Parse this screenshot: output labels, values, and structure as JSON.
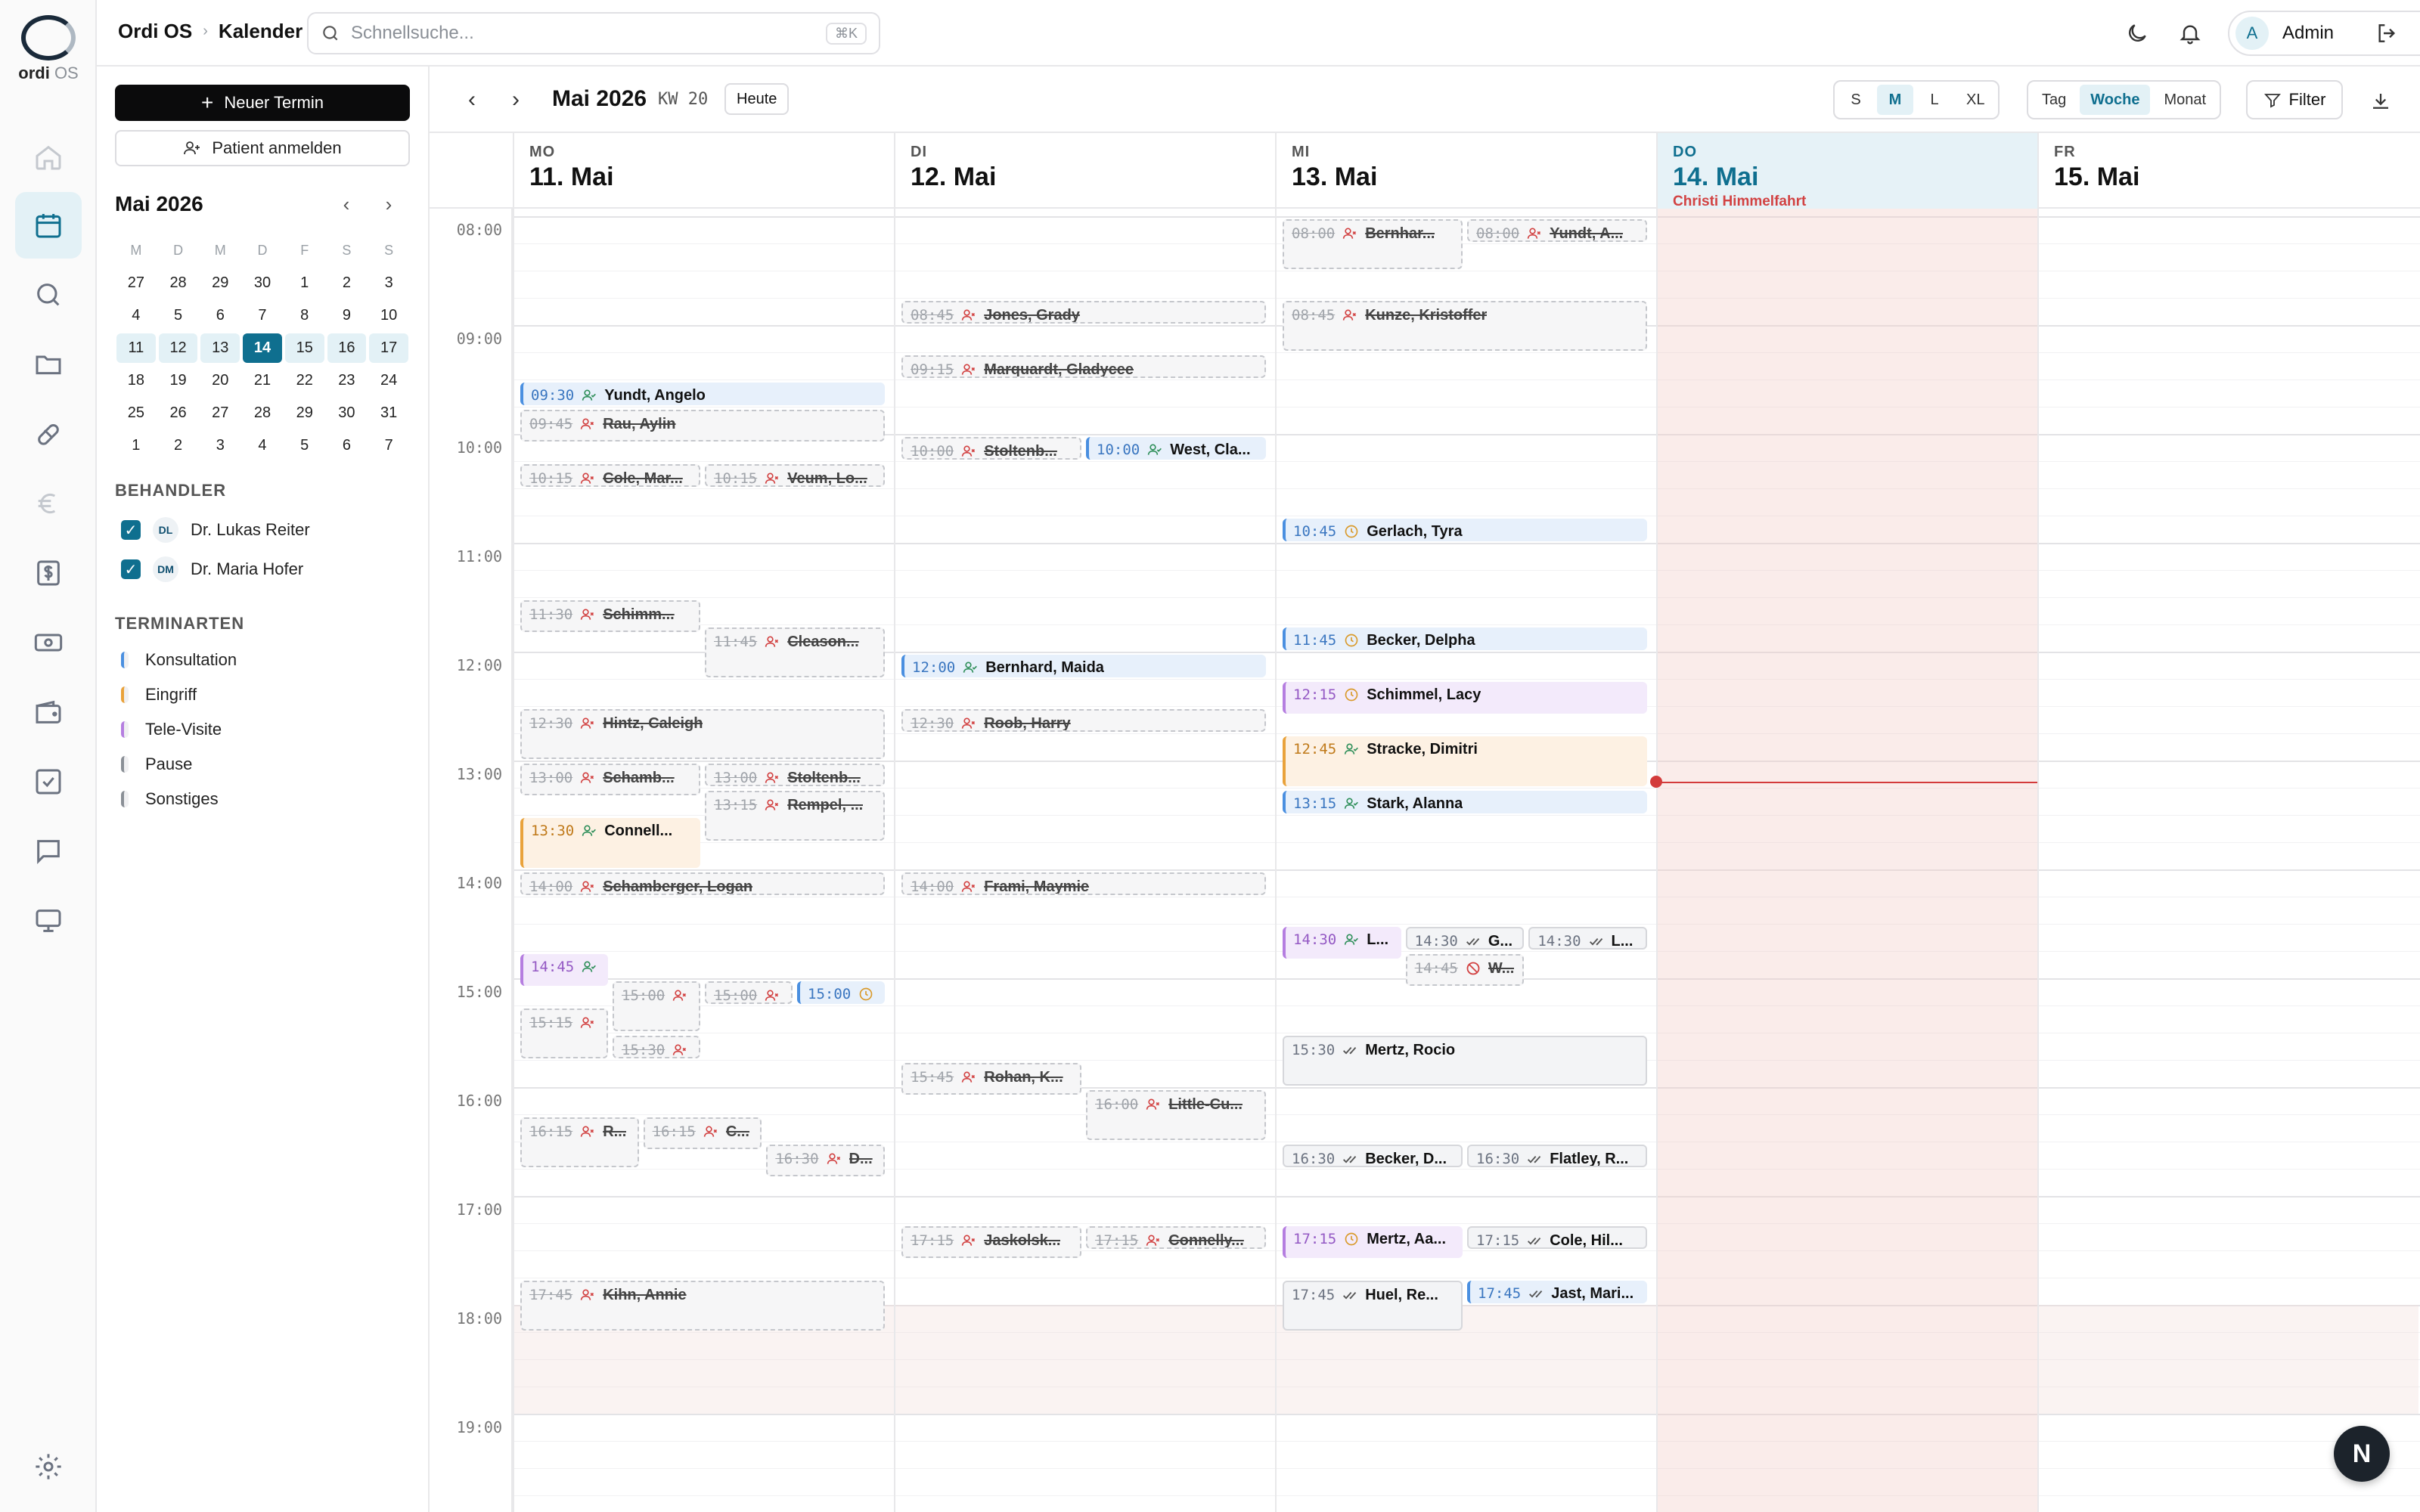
{
  "brand": {
    "name_a": "ordi",
    "name_b": "OS"
  },
  "breadcrumb": {
    "app": "Ordi OS",
    "page": "Kalender"
  },
  "search": {
    "placeholder": "Schnellsuche...",
    "shortcut": "⌘K"
  },
  "user": {
    "initial": "A",
    "name": "Admin"
  },
  "sidebar": {
    "new_appointment": "Neuer Termin",
    "register_patient": "Patient anmelden",
    "mini_calendar": {
      "title": "Mai 2026",
      "weekdays": [
        "M",
        "D",
        "M",
        "D",
        "F",
        "S",
        "S"
      ],
      "weeks": [
        [
          "27",
          "28",
          "29",
          "30",
          "1",
          "2",
          "3"
        ],
        [
          "4",
          "5",
          "6",
          "7",
          "8",
          "9",
          "10"
        ],
        [
          "11",
          "12",
          "13",
          "14",
          "15",
          "16",
          "17"
        ],
        [
          "18",
          "19",
          "20",
          "21",
          "22",
          "23",
          "24"
        ],
        [
          "25",
          "26",
          "27",
          "28",
          "29",
          "30",
          "31"
        ],
        [
          "1",
          "2",
          "3",
          "4",
          "5",
          "6",
          "7"
        ]
      ],
      "selected_week_index": 2,
      "today_label": "14"
    },
    "providers_heading": "BEHANDLER",
    "providers": [
      {
        "initials": "DL",
        "name": "Dr. Lukas Reiter",
        "checked": true
      },
      {
        "initials": "DM",
        "name": "Dr. Maria Hofer",
        "checked": true
      }
    ],
    "types_heading": "TERMINARTEN",
    "types": [
      {
        "label": "Konsultation",
        "color": "#4a8fe0"
      },
      {
        "label": "Eingriff",
        "color": "#e9a23b"
      },
      {
        "label": "Tele-Visite",
        "color": "#b57ee0"
      },
      {
        "label": "Pause",
        "color": "#8a8f96"
      },
      {
        "label": "Sonstiges",
        "color": "#8a8f96"
      }
    ]
  },
  "toolbar": {
    "title": "Mai 2026",
    "week": "KW 20",
    "today": "Heute",
    "sizes": [
      "S",
      "M",
      "L",
      "XL"
    ],
    "active_size": "M",
    "views": [
      "Tag",
      "Woche",
      "Monat"
    ],
    "active_view": "Woche",
    "filter": "Filter"
  },
  "days": [
    {
      "dow": "MO",
      "date": "11. Mai",
      "holiday": ""
    },
    {
      "dow": "DI",
      "date": "12. Mai",
      "holiday": ""
    },
    {
      "dow": "MI",
      "date": "13. Mai",
      "holiday": ""
    },
    {
      "dow": "DO",
      "date": "14. Mai",
      "holiday": "Christi Himmelfahrt"
    },
    {
      "dow": "FR",
      "date": "15. Mai",
      "holiday": ""
    }
  ],
  "hours": [
    "08:00",
    "09:00",
    "10:00",
    "11:00",
    "12:00",
    "13:00",
    "14:00",
    "15:00",
    "16:00",
    "17:00",
    "18:00",
    "19:00"
  ],
  "now_time": "13:12",
  "appointments": [
    {
      "day": 0,
      "start": "09:30",
      "end": "09:45",
      "lane": 0,
      "lanes": 1,
      "time": "09:30",
      "name": "Yundt, Angelo",
      "style": "blue",
      "icon": "user-check-icon"
    },
    {
      "day": 0,
      "start": "09:45",
      "end": "10:05",
      "lane": 0,
      "lanes": 1,
      "time": "09:45",
      "name": "Rau, Aylin",
      "style": "cancel",
      "icon": "user-x-icon"
    },
    {
      "day": 0,
      "start": "10:15",
      "end": "10:30",
      "lane": 0,
      "lanes": 2,
      "time": "10:15",
      "name": "Cole, Mar...",
      "style": "cancel",
      "icon": "user-x-icon"
    },
    {
      "day": 0,
      "start": "10:15",
      "end": "10:30",
      "lane": 1,
      "lanes": 2,
      "time": "10:15",
      "name": "Veum, Lo...",
      "style": "cancel",
      "icon": "user-x-icon"
    },
    {
      "day": 0,
      "start": "11:30",
      "end": "11:50",
      "lane": 0,
      "lanes": 2,
      "time": "11:30",
      "name": "Schimm...",
      "style": "cancel",
      "icon": "user-x-icon"
    },
    {
      "day": 0,
      "start": "11:45",
      "end": "12:15",
      "lane": 1,
      "lanes": 2,
      "time": "11:45",
      "name": "Cleason...",
      "style": "cancel",
      "icon": "user-x-icon"
    },
    {
      "day": 0,
      "start": "12:30",
      "end": "13:00",
      "lane": 0,
      "lanes": 1,
      "time": "12:30",
      "name": "Hintz, Caleigh",
      "style": "cancel",
      "icon": "user-x-icon"
    },
    {
      "day": 0,
      "start": "13:00",
      "end": "13:20",
      "lane": 0,
      "lanes": 2,
      "time": "13:00",
      "name": "Schamb...",
      "style": "cancel",
      "icon": "user-x-icon"
    },
    {
      "day": 0,
      "start": "13:00",
      "end": "13:15",
      "lane": 1,
      "lanes": 2,
      "time": "13:00",
      "name": "Stoltenb...",
      "style": "cancel",
      "icon": "user-x-icon"
    },
    {
      "day": 0,
      "start": "13:15",
      "end": "13:45",
      "lane": 1,
      "lanes": 2,
      "time": "13:15",
      "name": "Rempel, ...",
      "style": "cancel",
      "icon": "user-x-icon"
    },
    {
      "day": 0,
      "start": "13:30",
      "end": "14:00",
      "lane": 0,
      "lanes": 2,
      "time": "13:30",
      "name": "Connell...",
      "style": "orange",
      "icon": "user-check-icon"
    },
    {
      "day": 0,
      "start": "14:00",
      "end": "14:15",
      "lane": 0,
      "lanes": 1,
      "time": "14:00",
      "name": "Schamberger, Logan",
      "style": "cancel",
      "icon": "user-x-icon"
    },
    {
      "day": 0,
      "start": "14:45",
      "end": "15:05",
      "lane": 0,
      "lanes": 4,
      "time": "14:45",
      "name": "",
      "style": "purple",
      "icon": "user-check-icon"
    },
    {
      "day": 0,
      "start": "15:00",
      "end": "15:30",
      "lane": 1,
      "lanes": 4,
      "time": "15:00",
      "name": "",
      "style": "cancel",
      "icon": "user-x-icon"
    },
    {
      "day": 0,
      "start": "15:00",
      "end": "15:15",
      "lane": 2,
      "lanes": 4,
      "time": "15:00",
      "name": "",
      "style": "cancel",
      "icon": "user-x-icon"
    },
    {
      "day": 0,
      "start": "15:00",
      "end": "15:15",
      "lane": 3,
      "lanes": 4,
      "time": "15:00",
      "name": "",
      "style": "blue",
      "icon": "clock-icon"
    },
    {
      "day": 0,
      "start": "15:15",
      "end": "15:45",
      "lane": 0,
      "lanes": 4,
      "time": "15:15",
      "name": "",
      "style": "cancel",
      "icon": "user-x-icon"
    },
    {
      "day": 0,
      "start": "15:30",
      "end": "15:45",
      "lane": 1,
      "lanes": 4,
      "time": "15:30",
      "name": "",
      "style": "cancel",
      "icon": "user-x-icon"
    },
    {
      "day": 0,
      "start": "16:15",
      "end": "16:45",
      "lane": 0,
      "lanes": 3,
      "time": "16:15",
      "name": "R...",
      "style": "cancel",
      "icon": "user-x-icon"
    },
    {
      "day": 0,
      "start": "16:15",
      "end": "16:35",
      "lane": 1,
      "lanes": 3,
      "time": "16:15",
      "name": "C...",
      "style": "cancel",
      "icon": "user-x-icon"
    },
    {
      "day": 0,
      "start": "16:30",
      "end": "16:50",
      "lane": 2,
      "lanes": 3,
      "time": "16:30",
      "name": "D...",
      "style": "cancel",
      "icon": "user-x-icon"
    },
    {
      "day": 0,
      "start": "17:45",
      "end": "18:15",
      "lane": 0,
      "lanes": 1,
      "time": "17:45",
      "name": "Kihn, Annie",
      "style": "cancel",
      "icon": "user-x-icon"
    },
    {
      "day": 1,
      "start": "08:45",
      "end": "09:00",
      "lane": 0,
      "lanes": 1,
      "time": "08:45",
      "name": "Jones, Grady",
      "style": "cancel",
      "icon": "user-x-icon"
    },
    {
      "day": 1,
      "start": "09:15",
      "end": "09:30",
      "lane": 0,
      "lanes": 1,
      "time": "09:15",
      "name": "Marquardt, Gladycee",
      "style": "cancel",
      "icon": "user-x-icon"
    },
    {
      "day": 1,
      "start": "10:00",
      "end": "10:15",
      "lane": 0,
      "lanes": 2,
      "time": "10:00",
      "name": "Stoltenb...",
      "style": "cancel",
      "icon": "user-x-icon"
    },
    {
      "day": 1,
      "start": "10:00",
      "end": "10:15",
      "lane": 1,
      "lanes": 2,
      "time": "10:00",
      "name": "West, Cla...",
      "style": "blue",
      "icon": "user-check-icon"
    },
    {
      "day": 1,
      "start": "12:00",
      "end": "12:15",
      "lane": 0,
      "lanes": 1,
      "time": "12:00",
      "name": "Bernhard, Maida",
      "style": "blue",
      "icon": "user-check-icon"
    },
    {
      "day": 1,
      "start": "12:30",
      "end": "12:45",
      "lane": 0,
      "lanes": 1,
      "time": "12:30",
      "name": "Roob, Harry",
      "style": "cancel",
      "icon": "user-x-icon"
    },
    {
      "day": 1,
      "start": "14:00",
      "end": "14:15",
      "lane": 0,
      "lanes": 1,
      "time": "14:00",
      "name": "Frami, Maymie",
      "style": "cancel",
      "icon": "user-x-icon"
    },
    {
      "day": 1,
      "start": "15:45",
      "end": "16:05",
      "lane": 0,
      "lanes": 2,
      "time": "15:45",
      "name": "Rohan, K...",
      "style": "cancel",
      "icon": "user-x-icon"
    },
    {
      "day": 1,
      "start": "16:00",
      "end": "16:30",
      "lane": 1,
      "lanes": 2,
      "time": "16:00",
      "name": "Little-Cu...",
      "style": "cancel",
      "icon": "user-x-icon"
    },
    {
      "day": 1,
      "start": "17:15",
      "end": "17:35",
      "lane": 0,
      "lanes": 2,
      "time": "17:15",
      "name": "Jaskolsk...",
      "style": "cancel",
      "icon": "user-x-icon"
    },
    {
      "day": 1,
      "start": "17:15",
      "end": "17:30",
      "lane": 1,
      "lanes": 2,
      "time": "17:15",
      "name": "Connelly...",
      "style": "cancel",
      "icon": "user-x-icon"
    },
    {
      "day": 2,
      "start": "08:00",
      "end": "08:30",
      "lane": 0,
      "lanes": 2,
      "time": "08:00",
      "name": "Bernhar...",
      "style": "cancel",
      "icon": "user-x-icon"
    },
    {
      "day": 2,
      "start": "08:00",
      "end": "08:15",
      "lane": 1,
      "lanes": 2,
      "time": "08:00",
      "name": "Yundt, A...",
      "style": "cancel",
      "icon": "user-x-icon"
    },
    {
      "day": 2,
      "start": "08:45",
      "end": "09:15",
      "lane": 0,
      "lanes": 1,
      "time": "08:45",
      "name": "Kunze, Kristoffer",
      "style": "cancel",
      "icon": "user-x-icon"
    },
    {
      "day": 2,
      "start": "10:45",
      "end": "11:00",
      "lane": 0,
      "lanes": 1,
      "time": "10:45",
      "name": "Gerlach, Tyra",
      "style": "blue",
      "icon": "clock-icon"
    },
    {
      "day": 2,
      "start": "11:45",
      "end": "12:00",
      "lane": 0,
      "lanes": 1,
      "time": "11:45",
      "name": "Becker, Delpha",
      "style": "blue",
      "icon": "clock-icon"
    },
    {
      "day": 2,
      "start": "12:15",
      "end": "12:35",
      "lane": 0,
      "lanes": 1,
      "time": "12:15",
      "name": "Schimmel, Lacy",
      "style": "purple",
      "icon": "clock-icon"
    },
    {
      "day": 2,
      "start": "12:45",
      "end": "13:15",
      "lane": 0,
      "lanes": 1,
      "time": "12:45",
      "name": "Stracke, Dimitri",
      "style": "orange",
      "icon": "user-check-icon"
    },
    {
      "day": 2,
      "start": "13:15",
      "end": "13:30",
      "lane": 0,
      "lanes": 1,
      "time": "13:15",
      "name": "Stark, Alanna",
      "style": "blue",
      "icon": "user-check-icon"
    },
    {
      "day": 2,
      "start": "14:30",
      "end": "14:50",
      "lane": 0,
      "lanes": 3,
      "time": "14:30",
      "name": "L...",
      "style": "purple",
      "icon": "user-check-icon"
    },
    {
      "day": 2,
      "start": "14:30",
      "end": "14:45",
      "lane": 1,
      "lanes": 3,
      "time": "14:30",
      "name": "G...",
      "style": "gray",
      "icon": "check-icon"
    },
    {
      "day": 2,
      "start": "14:30",
      "end": "14:45",
      "lane": 2,
      "lanes": 3,
      "time": "14:30",
      "name": "L...",
      "style": "gray",
      "icon": "check-icon"
    },
    {
      "day": 2,
      "start": "14:45",
      "end": "15:05",
      "lane": 1,
      "lanes": 3,
      "time": "14:45",
      "name": "W...",
      "style": "cancel",
      "icon": "ban-icon"
    },
    {
      "day": 2,
      "start": "15:30",
      "end": "16:00",
      "lane": 0,
      "lanes": 1,
      "time": "15:30",
      "name": "Mertz, Rocio",
      "style": "gray",
      "icon": "check-icon"
    },
    {
      "day": 2,
      "start": "16:30",
      "end": "16:45",
      "lane": 0,
      "lanes": 2,
      "time": "16:30",
      "name": "Becker, D...",
      "style": "gray",
      "icon": "check-icon"
    },
    {
      "day": 2,
      "start": "16:30",
      "end": "16:45",
      "lane": 1,
      "lanes": 2,
      "time": "16:30",
      "name": "Flatley, R...",
      "style": "gray",
      "icon": "check-icon"
    },
    {
      "day": 2,
      "start": "17:15",
      "end": "17:35",
      "lane": 0,
      "lanes": 2,
      "time": "17:15",
      "name": "Mertz, Aa...",
      "style": "purple",
      "icon": "clock-icon"
    },
    {
      "day": 2,
      "start": "17:15",
      "end": "17:30",
      "lane": 1,
      "lanes": 2,
      "time": "17:15",
      "name": "Cole, Hil...",
      "style": "gray",
      "icon": "check-icon"
    },
    {
      "day": 2,
      "start": "17:45",
      "end": "18:15",
      "lane": 0,
      "lanes": 2,
      "time": "17:45",
      "name": "Huel, Re...",
      "style": "gray",
      "icon": "check-icon"
    },
    {
      "day": 2,
      "start": "17:45",
      "end": "18:00",
      "lane": 1,
      "lanes": 2,
      "time": "17:45",
      "name": "Jast, Mari...",
      "style": "blue",
      "icon": "check-icon"
    }
  ],
  "fab": {
    "label": "N"
  }
}
